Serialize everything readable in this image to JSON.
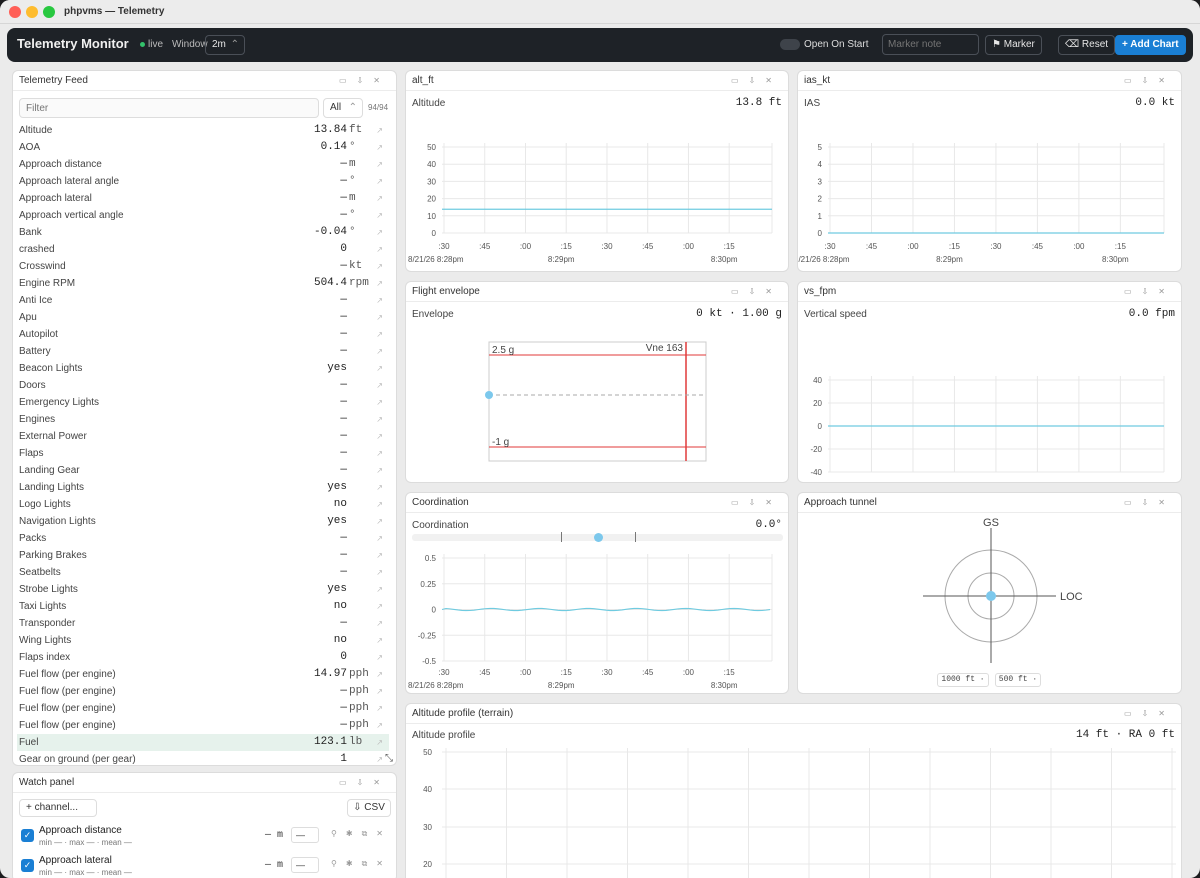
{
  "window": {
    "title": "phpvms — Telemetry"
  },
  "toolbar": {
    "title": "Telemetry Monitor",
    "live": "live",
    "window_label": "Window",
    "window_value": "2m",
    "open_on_start": "Open On Start",
    "marker_placeholder": "Marker note",
    "marker": "Marker",
    "reset": "Reset",
    "add_chart": "+ Add Chart"
  },
  "feed": {
    "title": "Telemetry Feed",
    "filter_placeholder": "Filter",
    "filter_select": "All",
    "count": "94/94",
    "rows": [
      {
        "name": "Altitude",
        "value": "13.84",
        "unit": "ft"
      },
      {
        "name": "AOA",
        "value": "0.14",
        "unit": "°"
      },
      {
        "name": "Approach distance",
        "value": "—",
        "unit": "m"
      },
      {
        "name": "Approach lateral angle",
        "value": "—",
        "unit": "°"
      },
      {
        "name": "Approach lateral",
        "value": "—",
        "unit": "m"
      },
      {
        "name": "Approach vertical angle",
        "value": "—",
        "unit": "°"
      },
      {
        "name": "Bank",
        "value": "-0.04",
        "unit": "°"
      },
      {
        "name": "crashed",
        "value": "0",
        "unit": ""
      },
      {
        "name": "Crosswind",
        "value": "—",
        "unit": "kt"
      },
      {
        "name": "Engine RPM",
        "value": "504.4",
        "unit": "rpm"
      },
      {
        "name": "Anti Ice",
        "value": "—",
        "unit": ""
      },
      {
        "name": "Apu",
        "value": "—",
        "unit": ""
      },
      {
        "name": "Autopilot",
        "value": "—",
        "unit": ""
      },
      {
        "name": "Battery",
        "value": "—",
        "unit": ""
      },
      {
        "name": "Beacon Lights",
        "value": "yes",
        "unit": ""
      },
      {
        "name": "Doors",
        "value": "—",
        "unit": ""
      },
      {
        "name": "Emergency Lights",
        "value": "—",
        "unit": ""
      },
      {
        "name": "Engines",
        "value": "—",
        "unit": ""
      },
      {
        "name": "External Power",
        "value": "—",
        "unit": ""
      },
      {
        "name": "Flaps",
        "value": "—",
        "unit": ""
      },
      {
        "name": "Landing Gear",
        "value": "—",
        "unit": ""
      },
      {
        "name": "Landing Lights",
        "value": "yes",
        "unit": ""
      },
      {
        "name": "Logo Lights",
        "value": "no",
        "unit": ""
      },
      {
        "name": "Navigation Lights",
        "value": "yes",
        "unit": ""
      },
      {
        "name": "Packs",
        "value": "—",
        "unit": ""
      },
      {
        "name": "Parking Brakes",
        "value": "—",
        "unit": ""
      },
      {
        "name": "Seatbelts",
        "value": "—",
        "unit": ""
      },
      {
        "name": "Strobe Lights",
        "value": "yes",
        "unit": ""
      },
      {
        "name": "Taxi Lights",
        "value": "no",
        "unit": ""
      },
      {
        "name": "Transponder",
        "value": "—",
        "unit": ""
      },
      {
        "name": "Wing Lights",
        "value": "no",
        "unit": ""
      },
      {
        "name": "Flaps index",
        "value": "0",
        "unit": ""
      },
      {
        "name": "Fuel flow (per engine)",
        "value": "14.97",
        "unit": "pph"
      },
      {
        "name": "Fuel flow (per engine)",
        "value": "—",
        "unit": "pph"
      },
      {
        "name": "Fuel flow (per engine)",
        "value": "—",
        "unit": "pph"
      },
      {
        "name": "Fuel flow (per engine)",
        "value": "—",
        "unit": "pph"
      },
      {
        "name": "Fuel",
        "value": "123.1",
        "unit": "lb"
      },
      {
        "name": "Gear on ground (per gear)",
        "value": "1",
        "unit": ""
      }
    ]
  },
  "watch": {
    "title": "Watch panel",
    "add_channel": "+ channel...",
    "csv": "CSV",
    "rows": [
      {
        "name": "Approach distance",
        "stats": "min — · max — · mean —",
        "value": "—",
        "unit": "m",
        "select": "—"
      },
      {
        "name": "Approach lateral",
        "stats": "min — · max — · mean —",
        "value": "—",
        "unit": "m",
        "select": "—"
      }
    ]
  },
  "time_axis": {
    "ticks": [
      ":30",
      ":45",
      ":00",
      ":15",
      ":30",
      ":45",
      ":00",
      ":15"
    ],
    "date_label": "8/21/26 8:28pm",
    "label_829": "8:29pm",
    "label_830": "8:30pm"
  },
  "alt": {
    "title": "alt_ft",
    "label": "Altitude",
    "value": "13.8 ft",
    "yticks": [
      "50",
      "40",
      "30",
      "20",
      "10",
      "0"
    ]
  },
  "ias": {
    "title": "ias_kt",
    "label": "IAS",
    "value": "0.0 kt",
    "yticks": [
      "5",
      "4",
      "3",
      "2",
      "1",
      "0"
    ]
  },
  "envelope": {
    "title": "Flight envelope",
    "label": "Envelope",
    "value": "0 kt · 1.00 g",
    "upper": "2.5 g",
    "lower": "-1 g",
    "vne": "Vne 163"
  },
  "vs": {
    "title": "vs_fpm",
    "label": "Vertical speed",
    "value": "0.0 fpm",
    "yticks": [
      "40",
      "20",
      "0",
      "-20",
      "-40"
    ]
  },
  "coord": {
    "title": "Coordination",
    "label": "Coordination",
    "value": "0.0°",
    "yticks": [
      "0.5",
      "0.25",
      "0",
      "-0.25",
      "-0.5"
    ]
  },
  "tunnel": {
    "title": "Approach tunnel",
    "gs": "GS",
    "loc": "LOC",
    "btn1": "1000 ft",
    "btn2": "500 ft"
  },
  "profile": {
    "title": "Altitude profile (terrain)",
    "label": "Altitude profile",
    "value": "14 ft · RA 0 ft",
    "yticks": [
      "50",
      "40",
      "30",
      "20"
    ]
  },
  "colors": {
    "accent": "#1a7fd4",
    "line": "#6fcbe0",
    "red": "#e03a3a"
  },
  "chart_data": [
    {
      "type": "line",
      "title": "alt_ft",
      "ylabel": "Altitude",
      "ylim": [
        0,
        50
      ],
      "series": [
        {
          "name": "Altitude",
          "values": [
            13.8,
            13.8
          ]
        }
      ]
    },
    {
      "type": "line",
      "title": "ias_kt",
      "ylabel": "IAS",
      "ylim": [
        0,
        5
      ],
      "series": [
        {
          "name": "IAS",
          "values": [
            0,
            0
          ]
        }
      ]
    },
    {
      "type": "line",
      "title": "vs_fpm",
      "ylabel": "Vertical speed",
      "ylim": [
        -40,
        40
      ],
      "series": [
        {
          "name": "Vertical speed",
          "values": [
            0,
            0
          ]
        }
      ]
    },
    {
      "type": "line",
      "title": "Coordination",
      "ylabel": "Coordination",
      "ylim": [
        -0.5,
        0.5
      ],
      "series": [
        {
          "name": "Coordination",
          "values": [
            0,
            0
          ]
        }
      ]
    }
  ]
}
